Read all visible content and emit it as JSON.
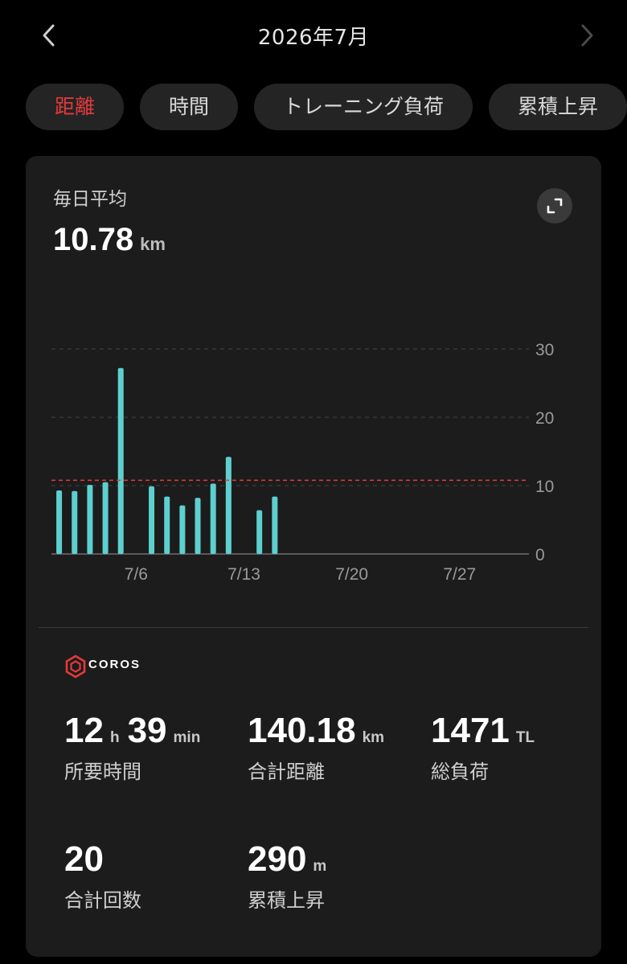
{
  "header": {
    "title": "2026年7月",
    "prev_icon": "chevron-left-icon",
    "next_icon": "chevron-right-icon"
  },
  "tabs": [
    {
      "label": "距離",
      "active": true
    },
    {
      "label": "時間",
      "active": false
    },
    {
      "label": "トレーニング負荷",
      "active": false
    },
    {
      "label": "累積上昇",
      "active": false
    }
  ],
  "summary": {
    "label": "毎日平均",
    "value": "10.78",
    "unit": "km",
    "expand_icon": "expand-icon"
  },
  "chart_data": {
    "type": "bar",
    "x_min_day": 1,
    "x_max_day": 31,
    "days": [
      1,
      2,
      3,
      4,
      5,
      7,
      8,
      9,
      10,
      11,
      12,
      14,
      15
    ],
    "values": [
      9.3,
      9.2,
      10.1,
      10.5,
      27.2,
      9.9,
      8.4,
      7.1,
      8.2,
      10.3,
      14.2,
      6.4,
      8.4
    ],
    "x_ticks": [
      {
        "day": 6,
        "label": "7/6"
      },
      {
        "day": 13,
        "label": "7/13"
      },
      {
        "day": 20,
        "label": "7/20"
      },
      {
        "day": 27,
        "label": "7/27"
      }
    ],
    "y_ticks": [
      {
        "value": 0,
        "label": "0"
      },
      {
        "value": 10,
        "label": "10"
      },
      {
        "value": 20,
        "label": "20"
      },
      {
        "value": 30,
        "label": "30"
      }
    ],
    "ylim": [
      0,
      30
    ],
    "average_line": 10.78,
    "bar_color": "#5ecfcf",
    "average_color": "#e5393b"
  },
  "brand": {
    "name": "COROS",
    "color": "#e5393b"
  },
  "stats": [
    {
      "parts": [
        {
          "value": "12",
          "unit": "h"
        },
        {
          "value": "39",
          "unit": "min"
        }
      ],
      "label": "所要時間"
    },
    {
      "parts": [
        {
          "value": "140.18",
          "unit": "km"
        }
      ],
      "label": "合計距離"
    },
    {
      "parts": [
        {
          "value": "1471",
          "unit": "TL"
        }
      ],
      "label": "総負荷"
    },
    {
      "parts": [
        {
          "value": "20",
          "unit": ""
        }
      ],
      "label": "合計回数"
    },
    {
      "parts": [
        {
          "value": "290",
          "unit": "m"
        }
      ],
      "label": "累積上昇"
    }
  ]
}
